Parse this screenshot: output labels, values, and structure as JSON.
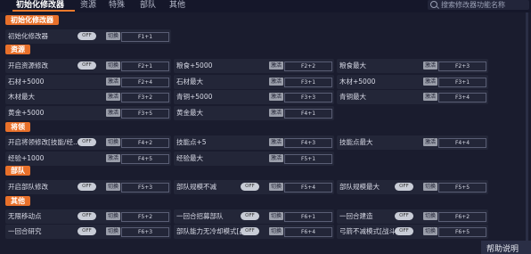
{
  "tabs": [
    "初始化修改器",
    "资源",
    "特殊",
    "部队",
    "其他"
  ],
  "search_placeholder": "搜索修改器功能名称",
  "help_label": "帮助说明",
  "toggle_off": "OFF",
  "switch_label": "切换",
  "activate_label": "激活",
  "sections": [
    {
      "title": "初始化修改器",
      "rows": [
        [
          {
            "label": "初始化修改器",
            "kind": "toggle",
            "key": "F1+1"
          }
        ]
      ]
    },
    {
      "title": "资源",
      "rows": [
        [
          {
            "label": "开启资源修改",
            "kind": "toggle",
            "key": "F2+1"
          },
          {
            "label": "粮食+5000",
            "kind": "act",
            "key": "F2+2"
          },
          {
            "label": "粮食最大",
            "kind": "act",
            "key": "F2+3"
          }
        ],
        [
          {
            "label": "石材+5000",
            "kind": "act",
            "key": "F2+4"
          },
          {
            "label": "石材最大",
            "kind": "act",
            "key": "F3+1"
          },
          {
            "label": "木材+5000",
            "kind": "act",
            "key": "F3+1"
          }
        ],
        [
          {
            "label": "木材最大",
            "kind": "act",
            "key": "F3+2"
          },
          {
            "label": "青铜+5000",
            "kind": "act",
            "key": "F3+3"
          },
          {
            "label": "青铜最大",
            "kind": "act",
            "key": "F3+4"
          }
        ],
        [
          {
            "label": "黄金+5000",
            "kind": "act",
            "key": "F3+5"
          },
          {
            "label": "黄金最大",
            "kind": "act",
            "key": "F4+1"
          }
        ]
      ]
    },
    {
      "title": "将领",
      "rows": [
        [
          {
            "label": "开启将领修改[技能/经...",
            "kind": "toggle",
            "key": "F4+2"
          },
          {
            "label": "技能点+5",
            "kind": "act",
            "key": "F4+3"
          },
          {
            "label": "技能点最大",
            "kind": "act",
            "key": "F4+4"
          }
        ],
        [
          {
            "label": "经验+1000",
            "kind": "act",
            "key": "F4+5"
          },
          {
            "label": "经验最大",
            "kind": "act",
            "key": "F5+1"
          }
        ]
      ]
    },
    {
      "title": "部队",
      "rows": [
        [
          {
            "label": "开启部队修改",
            "kind": "toggle",
            "key": "F5+3"
          },
          {
            "label": "部队规模不减",
            "kind": "toggle",
            "key": "F5+4"
          },
          {
            "label": "部队规模最大",
            "kind": "toggle",
            "key": "F5+5"
          }
        ]
      ]
    },
    {
      "title": "其他",
      "rows": [
        [
          {
            "label": "无限移动点",
            "kind": "toggle",
            "key": "F5+2"
          },
          {
            "label": "一回合招募部队",
            "kind": "toggle",
            "key": "F6+1"
          },
          {
            "label": "一回合建造",
            "kind": "toggle",
            "key": "F6+2"
          }
        ],
        [
          {
            "label": "一回合研究",
            "kind": "toggle",
            "key": "F6+3"
          },
          {
            "label": "部队能力无冷却模式[战斗]",
            "kind": "toggle",
            "key": "F6+4"
          },
          {
            "label": "弓箭不减模式[战斗]",
            "kind": "toggle",
            "key": "F6+5"
          }
        ]
      ]
    }
  ],
  "colors": {
    "accent": "#e8702a",
    "bg": "#1a1c2e",
    "cell": "#232638"
  }
}
